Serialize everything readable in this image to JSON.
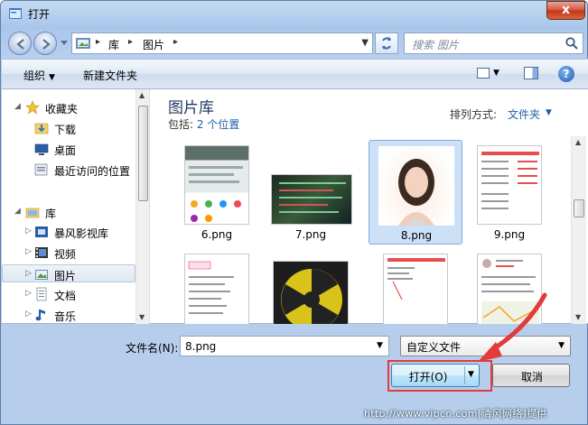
{
  "window": {
    "title": "打开",
    "close_label": "x"
  },
  "address": {
    "breadcrumbs": [
      "库",
      "图片"
    ]
  },
  "search": {
    "placeholder": "搜索 图片"
  },
  "toolbar": {
    "organize_label": "组织",
    "new_folder_label": "新建文件夹"
  },
  "nav": {
    "items": [
      {
        "label": "收藏夹",
        "icon": "star-icon"
      },
      {
        "label": "下载",
        "icon": "download-folder-icon"
      },
      {
        "label": "桌面",
        "icon": "desktop-icon"
      },
      {
        "label": "最近访问的位置",
        "icon": "recent-places-icon"
      },
      {
        "label": "库",
        "icon": "library-icon"
      },
      {
        "label": "暴风影视库",
        "icon": "video-library-icon"
      },
      {
        "label": "视频",
        "icon": "video-icon"
      },
      {
        "label": "图片",
        "icon": "pictures-icon"
      },
      {
        "label": "文档",
        "icon": "documents-icon"
      },
      {
        "label": "音乐",
        "icon": "music-icon"
      }
    ],
    "selected": "图片"
  },
  "library": {
    "title": "图片库",
    "includes_prefix": "包括:",
    "includes_link": "2 个位置",
    "arrange_label": "排列方式:",
    "arrange_value": "文件夹"
  },
  "files": [
    {
      "name": "6.png"
    },
    {
      "name": "7.png"
    },
    {
      "name": "8.png"
    },
    {
      "name": "9.png"
    },
    {
      "name": ""
    },
    {
      "name": ""
    },
    {
      "name": ""
    },
    {
      "name": ""
    }
  ],
  "selected_file": "8.png",
  "bottom": {
    "filename_label": "文件名(N):",
    "filename_value": "8.png",
    "filter_value": "自定义文件",
    "open_label": "打开(O)",
    "cancel_label": "取消"
  },
  "watermark": "http://www.vipcn.com[清风网络]提供",
  "colors": {
    "accent": "#1f5fa8",
    "selection": "#cce0f7",
    "annotation_red": "#e23b3b"
  }
}
